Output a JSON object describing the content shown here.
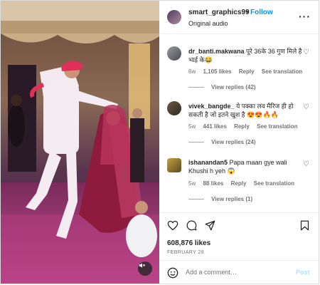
{
  "post": {
    "username": "smart_graphics99",
    "dot": "•",
    "follow_label": "Follow",
    "audio": "Original audio",
    "more_icon": "more-horizontal-icon"
  },
  "comments": [
    {
      "username": "dr_banti.makwana",
      "text": "पूरे 36के 36 गुण मिले है भाई के😂",
      "age": "6w",
      "likes": "1,105 likes",
      "reply": "Reply",
      "see_translation": "See translation",
      "view_replies": "View replies (42)"
    },
    {
      "username": "vivek_bangde_",
      "text": "ये पक्का लव मैरिज ही हो सकती है जो इतने खुश है 😍😍🔥🔥",
      "age": "5w",
      "likes": "441 likes",
      "reply": "Reply",
      "see_translation": "See translation",
      "view_replies": "View replies (24)"
    },
    {
      "username": "ishanandan5",
      "text": "Papa maan gye wali Khushi h yeh 😱",
      "age": "5w",
      "likes": "88 likes",
      "reply": "Reply",
      "see_translation": "See translation",
      "view_replies": "View replies (1)"
    }
  ],
  "actions": {
    "likes": "608,876 likes",
    "date": "FEBRUARY 28",
    "add_comment_placeholder": "Add a comment…",
    "post_label": "Post"
  },
  "colors": {
    "link_blue": "#0095f6",
    "post_disabled": "#b2dffc",
    "meta_gray": "#737373"
  }
}
